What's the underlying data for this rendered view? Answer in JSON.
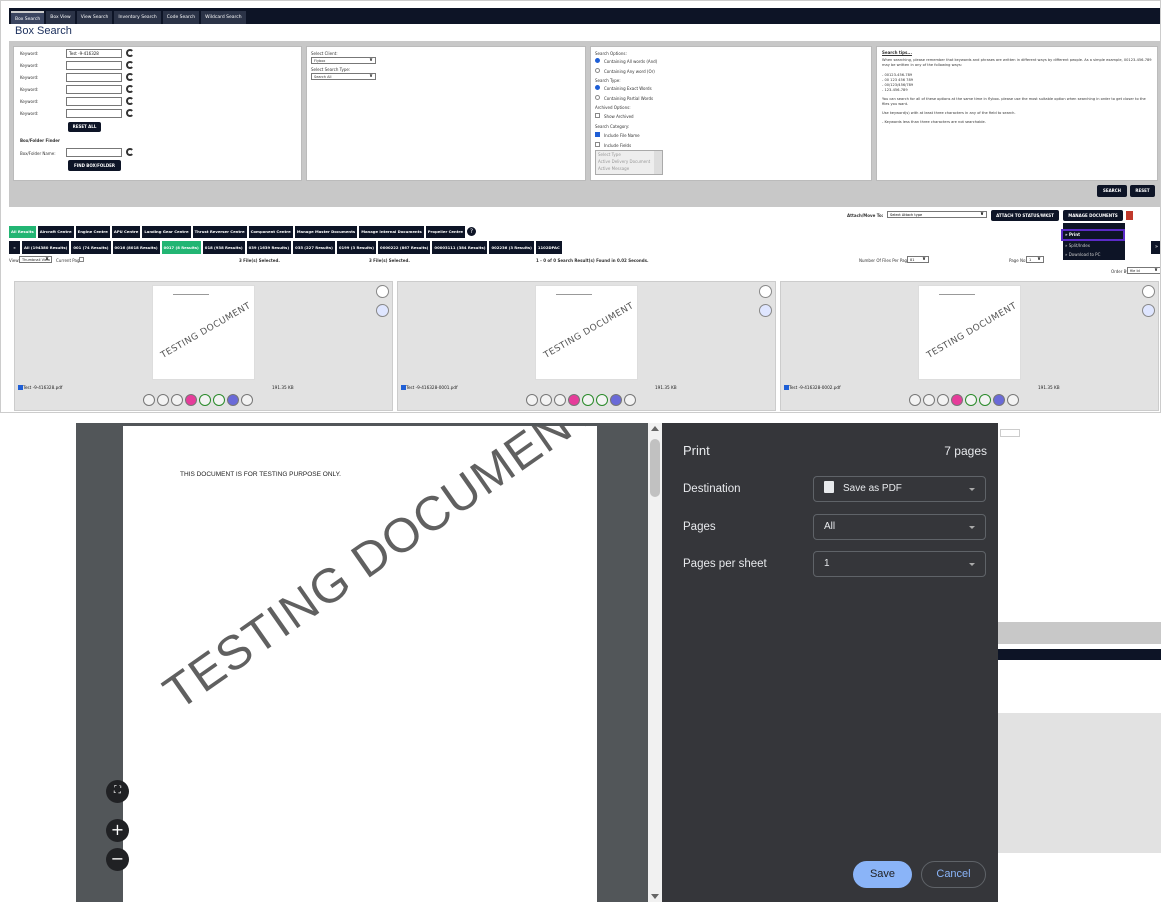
{
  "app": {
    "tabs": [
      "Box Search",
      "Box View",
      "View Search",
      "Inventory Search",
      "Code Search",
      "Wildcard Search"
    ],
    "title": "Box Search"
  },
  "keywords": {
    "label": "Keyword:",
    "first_value": "Test -9-416328",
    "reset_label": "RESET ALL",
    "finder_title": "Box/Folder Finder",
    "finder_label": "Box/Folder Name:",
    "find_label": "FIND BOX/FOLDER"
  },
  "client": {
    "select_client_label": "Select Client:",
    "client_value": "Flybox",
    "search_type_label": "Select Search Type:",
    "search_type_value": "Search All"
  },
  "options": {
    "title": "Search Options:",
    "all_words": "Containing All words (And)",
    "any_word": "Containing Any word (Or)",
    "search_type_title": "Search Type:",
    "exact": "Containing Exact Words",
    "partial": "Containing Partial Words",
    "archived_title": "Archived Options:",
    "show_archived": "Show Archived",
    "category_title": "Search Category:",
    "include_file_name": "Include File Name",
    "include_fields": "Include Fields",
    "list_items": [
      "Select Type",
      "Active Delivery Document",
      "Active Message"
    ]
  },
  "tips": {
    "title": "Search tips...",
    "p1": "When searching, please remember that keywords and phrases are written in different ways by different people. As a simple example, 00123-456-789 may be written in any of the following ways:",
    "p2": "- 00123-456-789",
    "p3": "- 00 123 456 789",
    "p4": "- 00/123/456/789",
    "p5": "- 123-456-789",
    "p6": "You can search for all of these options at the same time in flybox- please use the most suitable option when searching in order to get closer to the files you want.",
    "p7": "Use keyword(s) with at least three characters in any of the field to search.",
    "p8": "- Keywords less than three characters are not searchable."
  },
  "search_buttons": {
    "search": "SEARCH",
    "reset": "RESET"
  },
  "attach": {
    "label": "Attach/Move To:",
    "select": "Select Attach type",
    "attach_btn": "ATTACH TO STATUS/WKST",
    "manage_btn": "MANAGE DOCUMENTS",
    "menu": [
      "» Print",
      "» Split/Index",
      "» Download to PC"
    ]
  },
  "categories": [
    "All Results",
    "Aircraft Centre",
    "Engine Centre",
    "APU Centre",
    "Landing Gear Centre",
    "Thrust Reverser Centre",
    "Component Centre",
    "Manage Master Documents",
    "Manage Internal Documents",
    "Propeller Centre"
  ],
  "results": [
    "All (194380 Results)",
    "001 (74 Results)",
    "0016 (8018 Results)",
    "0017 (8 Results)",
    "018 (938 Results)",
    "039 (1639 Results)",
    "035 (227 Results)",
    "0199 (3 Results)",
    "0000222 (867 Results)",
    "00003111 (384 Results)",
    "002236 (3 Results)",
    "1102DPAC"
  ],
  "info": {
    "view_label": "View:",
    "view_value": "Thumbnail View",
    "current_page": "Current Page",
    "selected1": "3 File(s) Selected.",
    "selected2": "3 File(s) Selected.",
    "found": "1 - 0 of 0 Search Result(s) Found in 0.02 Seconds.",
    "per_page_label": "Number Of Files Per Page:",
    "per_page_value": "81",
    "page_label": "Page No:",
    "page_value": "1",
    "order_label": "Order By:",
    "order_value": "file Id"
  },
  "cards": [
    {
      "name": "Test -9-416328.pdf",
      "size": "191.35 KB",
      "watermark": "TESTING DOCUMENT"
    },
    {
      "name": "Test -9-416328-0001.pdf",
      "size": "191.35 KB",
      "watermark": "TESTING DOCUMENT"
    },
    {
      "name": "Test -9-416328-0002.pdf",
      "size": "191.35 KB",
      "watermark": "TESTING DOCUMENT"
    }
  ],
  "print": {
    "notice": "THIS DOCUMENT IS FOR TESTING PURPOSE ONLY.",
    "watermark": "TESTING DOCUMENT",
    "title": "Print",
    "page_count": "7 pages",
    "destination_label": "Destination",
    "destination_value": "Save as PDF",
    "pages_label": "Pages",
    "pages_value": "All",
    "pps_label": "Pages per sheet",
    "pps_value": "1",
    "save": "Save",
    "cancel": "Cancel"
  },
  "colors": {
    "nav_dark": "#0d1426",
    "accent_green": "#22b573",
    "print_panel": "#35363a",
    "save_blue": "#8ab4f8"
  }
}
